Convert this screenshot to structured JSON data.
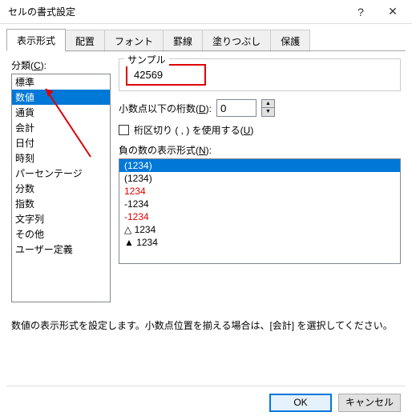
{
  "titlebar": {
    "title": "セルの書式設定"
  },
  "tabs": {
    "items": [
      "表示形式",
      "配置",
      "フォント",
      "罫線",
      "塗りつぶし",
      "保護"
    ],
    "active_index": 0
  },
  "category": {
    "label_prefix": "分類(",
    "label_key": "C",
    "label_suffix": "):",
    "items": [
      "標準",
      "数値",
      "通貨",
      "会計",
      "日付",
      "時刻",
      "パーセンテージ",
      "分数",
      "指数",
      "文字列",
      "その他",
      "ユーザー定義"
    ],
    "selected_index": 1
  },
  "sample": {
    "label": "サンプル",
    "value": "42569"
  },
  "decimals": {
    "label_prefix": "小数点以下の桁数(",
    "label_key": "D",
    "label_suffix": "):",
    "value": "0"
  },
  "separator": {
    "label_prefix": "桁区切り ( , ) を使用する(",
    "label_key": "U",
    "label_suffix": ")",
    "checked": false
  },
  "neg": {
    "label_prefix": "負の数の表示形式(",
    "label_key": "N",
    "label_suffix": "):",
    "items": [
      {
        "text": "(1234)",
        "red": true,
        "selected": true
      },
      {
        "text": "(1234)",
        "red": false
      },
      {
        "text": "1234",
        "red": true
      },
      {
        "text": "-1234",
        "red": false
      },
      {
        "text": "-1234",
        "red": true
      },
      {
        "text": "△ 1234",
        "red": false
      },
      {
        "text": "▲ 1234",
        "red": false
      }
    ]
  },
  "note": "数値の表示形式を設定します。小数点位置を揃える場合は、[会計] を選択してください。",
  "footer": {
    "ok": "OK",
    "cancel": "キャンセル"
  }
}
